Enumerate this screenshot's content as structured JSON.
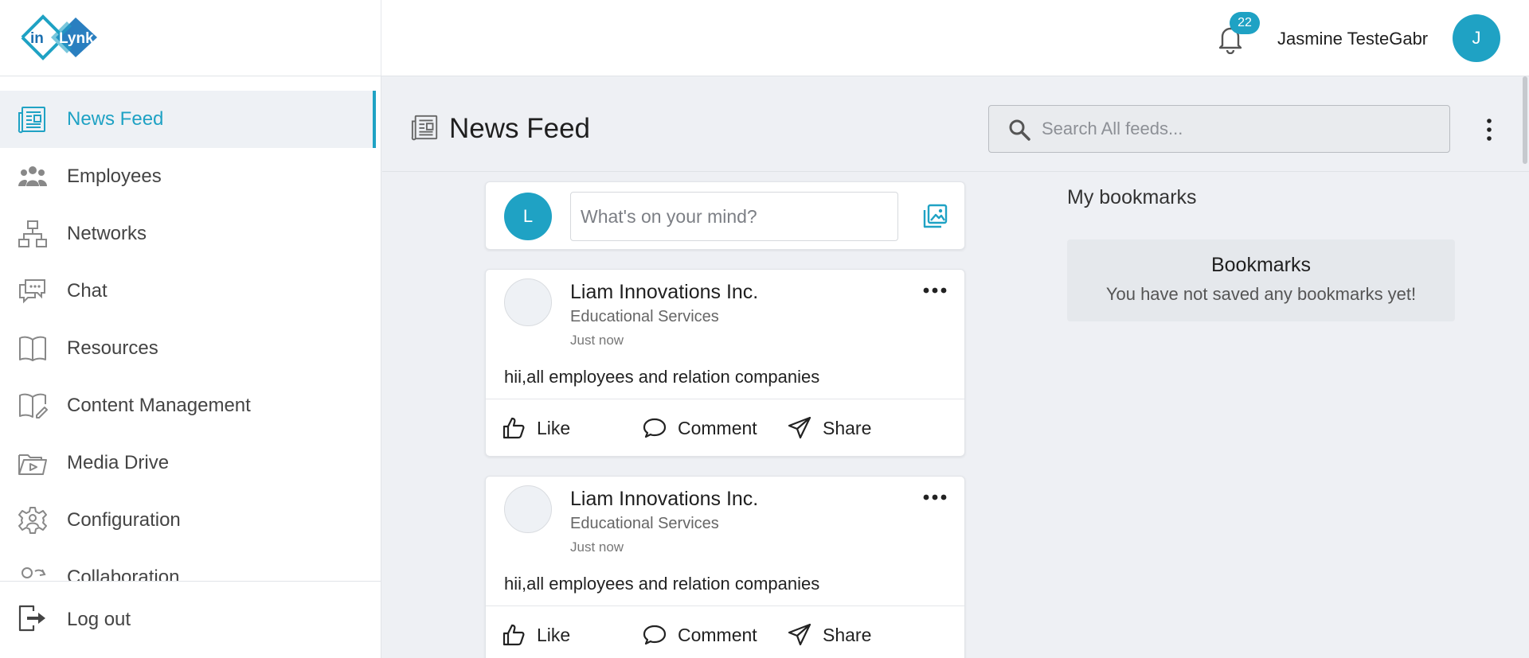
{
  "header": {
    "logo_text": "inLynk",
    "notification_count": "22",
    "user_name": "Jasmine TesteGabr",
    "user_initial": "J"
  },
  "sidebar": {
    "items": [
      {
        "label": "News Feed",
        "icon": "news-feed-icon",
        "active": true
      },
      {
        "label": "Employees",
        "icon": "employees-icon",
        "active": false
      },
      {
        "label": "Networks",
        "icon": "networks-icon",
        "active": false
      },
      {
        "label": "Chat",
        "icon": "chat-icon",
        "active": false
      },
      {
        "label": "Resources",
        "icon": "book-icon",
        "active": false
      },
      {
        "label": "Content Management",
        "icon": "content-management-icon",
        "active": false
      },
      {
        "label": "Media Drive",
        "icon": "media-drive-icon",
        "active": false
      },
      {
        "label": "Configuration",
        "icon": "gear-icon",
        "active": false
      },
      {
        "label": "Collaboration",
        "icon": "collaboration-icon",
        "active": false
      }
    ],
    "logout_label": "Log out"
  },
  "main": {
    "title": "News Feed",
    "search_placeholder": "Search All feeds...",
    "composer": {
      "avatar_initial": "L",
      "placeholder": "What's on your mind?"
    },
    "posts": [
      {
        "company": "Liam Innovations Inc.",
        "category": "Educational Services",
        "time": "Just now",
        "text": "hii,all employees and relation companies",
        "actions": {
          "like": "Like",
          "comment": "Comment",
          "share": "Share"
        }
      },
      {
        "company": "Liam Innovations Inc.",
        "category": "Educational Services",
        "time": "Just now",
        "text": "hii,all employees and relation companies",
        "actions": {
          "like": "Like",
          "comment": "Comment",
          "share": "Share"
        }
      }
    ],
    "bookmarks": {
      "section_title": "My bookmarks",
      "heading": "Bookmarks",
      "empty_message": "You have not saved any bookmarks yet!"
    }
  },
  "colors": {
    "accent": "#1fa2c4",
    "page_bg": "#eef0f4",
    "sidebar_active_bg": "#eef1f5"
  }
}
